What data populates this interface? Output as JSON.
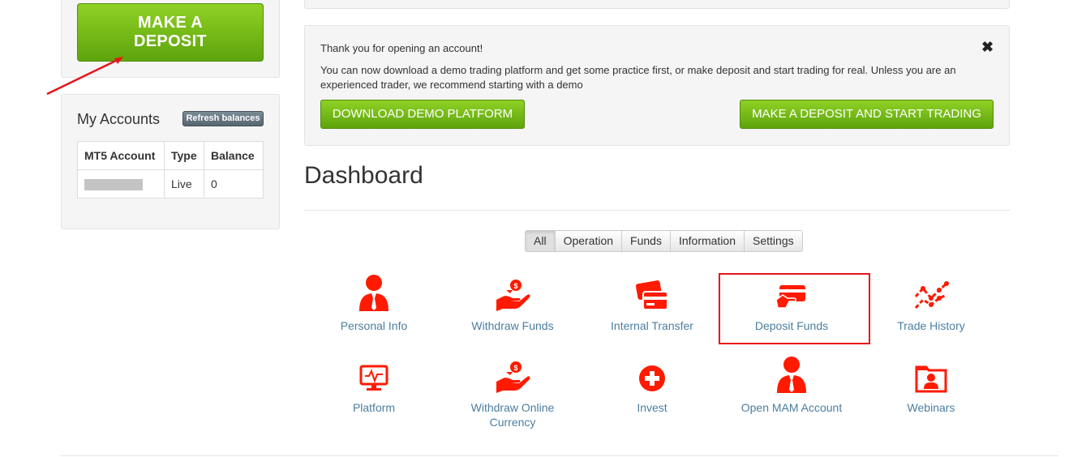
{
  "sidebar": {
    "deposit_button": "MAKE A DEPOSIT",
    "accounts_title": "My Accounts",
    "refresh_label": "Refresh balances",
    "table": {
      "headers": [
        "MT5 Account",
        "Type",
        "Balance"
      ],
      "rows": [
        {
          "type": "Live",
          "balance": "0"
        }
      ]
    }
  },
  "notice": {
    "title": "Thank you for opening an account!",
    "text": "You can now download a demo trading platform and get some practice first, or make deposit and start trading for real. Unless you are an experienced trader, we recommend starting with a demo",
    "close": "✖",
    "demo_button": "DOWNLOAD DEMO PLATFORM",
    "deposit_button": "MAKE A DEPOSIT AND START TRADING"
  },
  "dashboard": {
    "title": "Dashboard",
    "filters": [
      "All",
      "Operation",
      "Funds",
      "Information",
      "Settings"
    ],
    "active_filter": "All",
    "tiles": [
      {
        "label": "Personal Info",
        "icon": "person-icon"
      },
      {
        "label": "Withdraw Funds",
        "icon": "hand-coin-icon"
      },
      {
        "label": "Internal Transfer",
        "icon": "cards-icon"
      },
      {
        "label": "Deposit Funds",
        "icon": "card-hand-icon"
      },
      {
        "label": "Trade History",
        "icon": "chart-line-icon"
      },
      {
        "label": "Platform",
        "icon": "monitor-icon"
      },
      {
        "label": "Withdraw Online Currency",
        "icon": "hand-coin-icon"
      },
      {
        "label": "Invest",
        "icon": "plus-circle-icon"
      },
      {
        "label": "Open MAM Account",
        "icon": "person-icon"
      },
      {
        "label": "Webinars",
        "icon": "folder-person-icon"
      }
    ]
  },
  "colors": {
    "accent_red": "#ff1a00",
    "button_green": "#6cb515",
    "link_blue": "#4a7ea0",
    "highlight": "#e8141b"
  }
}
